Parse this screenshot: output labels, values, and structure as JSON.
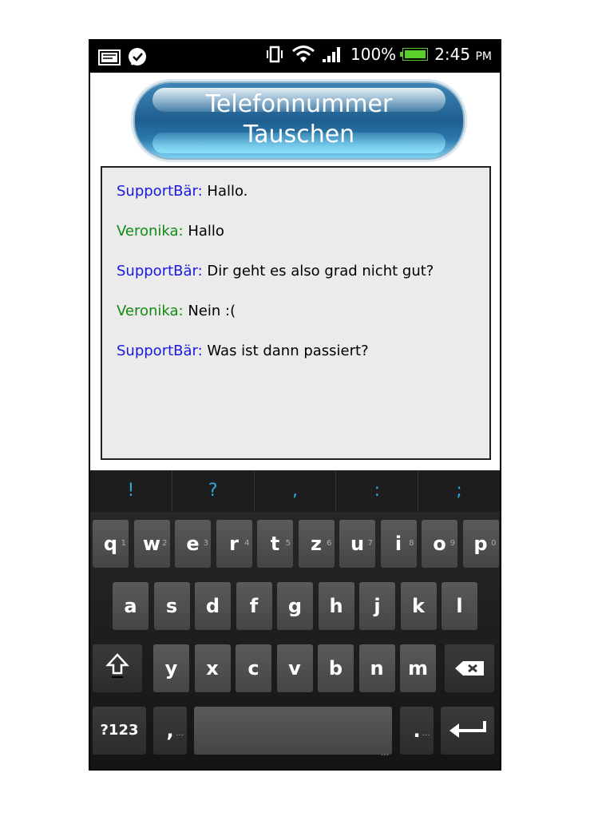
{
  "status_bar": {
    "battery": "100%",
    "time": "2:45",
    "ampm": "PM"
  },
  "header_button": {
    "label": "Telefonnummer\nTauschen"
  },
  "chat": {
    "messages": [
      {
        "sender": "SupportBär:",
        "text": " Hallo.",
        "role": "support"
      },
      {
        "sender": "Veronika:",
        "text": " Hallo",
        "role": "user"
      },
      {
        "sender": "SupportBär:",
        "text": " Dir geht es also grad nicht gut?",
        "role": "support"
      },
      {
        "sender": "Veronika:",
        "text": " Nein :(",
        "role": "user"
      },
      {
        "sender": "SupportBär:",
        "text": " Was ist dann passiert?",
        "role": "support"
      }
    ]
  },
  "keyboard": {
    "suggestions": [
      "!",
      "?",
      ",",
      ":",
      ";"
    ],
    "row1": [
      "q",
      "w",
      "e",
      "r",
      "t",
      "z",
      "u",
      "i",
      "o",
      "p"
    ],
    "row1_hints": [
      "1",
      "2",
      "3",
      "4",
      "5",
      "6",
      "7",
      "8",
      "9",
      "0"
    ],
    "row2": [
      "a",
      "s",
      "d",
      "f",
      "g",
      "h",
      "j",
      "k",
      "l"
    ],
    "row3": [
      "y",
      "x",
      "c",
      "v",
      "b",
      "n",
      "m"
    ],
    "symbols_label": "?123",
    "comma_label": ",",
    "period_label": "."
  },
  "colors": {
    "support": "#1a1ae0",
    "user": "#138a13",
    "suggestion": "#2fa6d8"
  }
}
